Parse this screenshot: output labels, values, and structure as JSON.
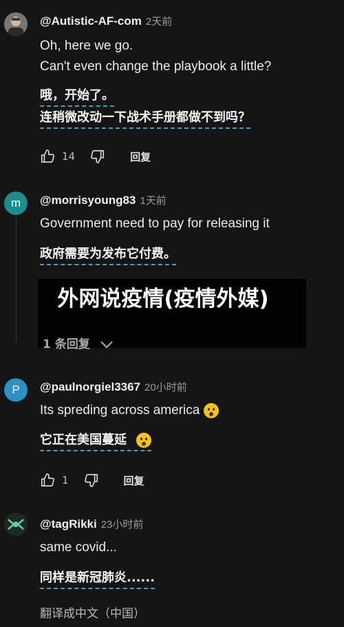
{
  "comments": [
    {
      "avatar": "",
      "user": "@Autistic-AF-com",
      "time": "2天前",
      "lines": [
        "Oh, here we go.",
        "Can't even change the playbook a little?"
      ],
      "translation_lines": [
        "哦，开始了。",
        "连稍微改动一下战术手册都做不到吗？"
      ],
      "likes": "14",
      "reply": "回复"
    },
    {
      "avatar": "m",
      "user": "@morrisyoung83",
      "time": "1天前",
      "lines": [
        "Government need to pay for releasing it"
      ],
      "translation_lines": [
        "政府需要为发布它付费。"
      ],
      "replies_toggle": "1 条回复"
    },
    {
      "avatar": "P",
      "user": "@paulnorgiel3367",
      "time": "20小时前",
      "lines": [
        "Its spreding across america"
      ],
      "translation_lines": [
        "它正在美国蔓延"
      ],
      "likes": "1",
      "reply": "回复"
    },
    {
      "avatar": "",
      "user": "@tagRikki",
      "time": "23小时前",
      "lines": [
        "same covid..."
      ],
      "translation_lines": [
        "同样是新冠肺炎......"
      ],
      "translate_link": "翻译成中文（中国）"
    }
  ],
  "overlay_title": "外网说疫情(疫情外媒)",
  "icons": {
    "like": "thumbs-up-icon",
    "dislike": "thumbs-down-icon",
    "chevron": "chevron-down-icon"
  },
  "colors": {
    "background": "#151515",
    "translation_underline": "#3aa3c8",
    "avatar_m": "#1c8d8d",
    "avatar_p": "#2e8ec6"
  }
}
